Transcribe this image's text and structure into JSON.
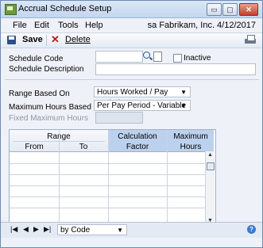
{
  "window": {
    "title": "Accrual Schedule Setup",
    "controls": {
      "minimize": "▭",
      "restore": "▢",
      "close": "✕"
    }
  },
  "menubar": {
    "items": [
      "File",
      "Edit",
      "Tools",
      "Help"
    ],
    "company_info": "sa  Fabrikam, Inc. 4/12/2017"
  },
  "toolbar": {
    "save_label": "Save",
    "delete_label": "Delete"
  },
  "form": {
    "schedule_code_label": "Schedule Code",
    "schedule_code_value": "",
    "inactive_label": "Inactive",
    "inactive_checked": false,
    "schedule_description_label": "Schedule Description",
    "schedule_description_value": "",
    "range_based_on_label": "Range Based On",
    "range_based_on_value": "Hours Worked / Pay Period",
    "max_hours_based_on_label": "Maximum Hours Based On",
    "max_hours_based_on_value": "Per Pay Period - Variable",
    "fixed_max_hours_label": "Fixed Maximum Hours",
    "fixed_max_hours_value": ""
  },
  "grid": {
    "range_header": "Range",
    "from_header": "From",
    "to_header": "To",
    "calc_header_1": "Calculation",
    "calc_header_2": "Factor",
    "max_header_1": "Maximum",
    "max_header_2": "Hours"
  },
  "footer": {
    "nav_first": "|◀",
    "nav_prev": "◀",
    "nav_next": "▶",
    "nav_last": "▶|",
    "sort_value": "by Code",
    "help": "?"
  },
  "colors": {
    "header_blue": "#bcd1ee",
    "titlebar": "#c4d6ee",
    "close_red": "#c2402a"
  }
}
